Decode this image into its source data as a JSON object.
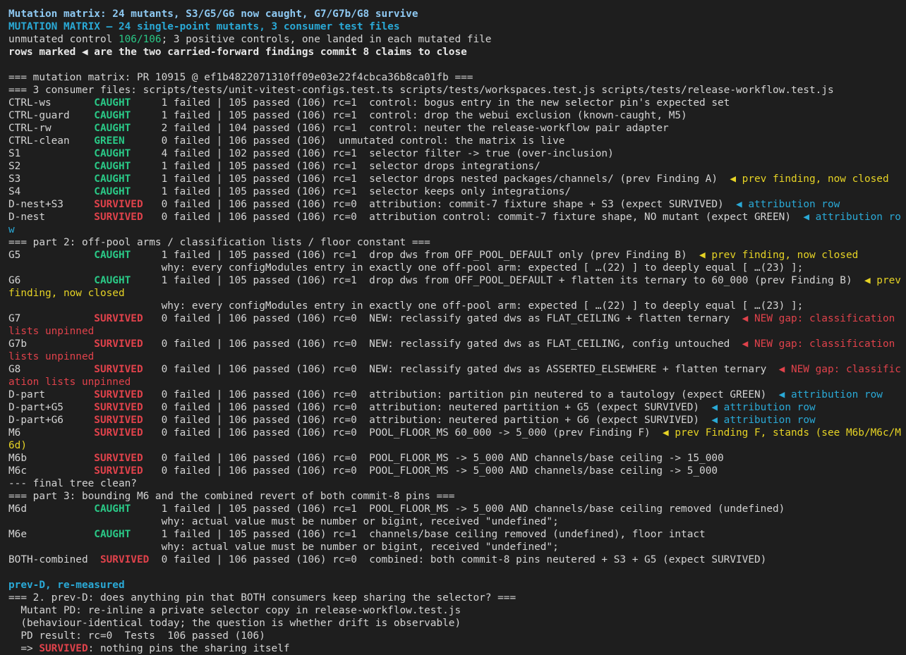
{
  "window": {
    "background": "#1e1e1e",
    "foreground": "#d4d4d4"
  },
  "colors": {
    "title": "#8ec9f2",
    "header": "#2aa9d6",
    "caught": "#2ac987",
    "survived": "#e0424b",
    "prev_finding": "#e6d325",
    "attribution": "#2aa9d6"
  },
  "lines": [
    {
      "name": "summary-title",
      "segs": [
        {
          "t": "Mutation matrix: 24 mutants, S3/G5/G6 now caught, G7/G7b/G8 survive",
          "c": "c-title bold"
        }
      ]
    },
    {
      "name": "summary-header",
      "segs": [
        {
          "t": "MUTATION MATRIX — 24 single-point mutants, 3 consumer test files",
          "c": "c-header bold"
        }
      ]
    },
    {
      "name": "summary-line",
      "segs": [
        {
          "t": "unmutated control "
        },
        {
          "t": "106/106",
          "c": "c-green"
        },
        {
          "t": "; 3 positive controls, one landed in each mutated file"
        }
      ]
    },
    {
      "name": "summary-line",
      "segs": [
        {
          "t": "rows marked ◀ are the two carried-forward findings commit 8 claims to close",
          "c": "c-white bold"
        }
      ]
    },
    {
      "name": "blank-line",
      "segs": [
        {
          "t": ""
        }
      ]
    },
    {
      "name": "section-header",
      "segs": [
        {
          "t": "=== mutation matrix: PR 10915 @ ef1b4822071310ff09e03e22f4cbca36b8ca01fb ==="
        }
      ]
    },
    {
      "name": "section-header",
      "segs": [
        {
          "t": "=== 3 consumer files: scripts/tests/unit-vitest-configs.test.ts scripts/tests/workspaces.test.js scripts/tests/release-workflow.test.js"
        }
      ]
    },
    {
      "name": "matrix-row",
      "segs": [
        {
          "t": "CTRL-ws       "
        },
        {
          "t": "CAUGHT",
          "c": "c-green bold"
        },
        {
          "t": "     1 failed | 105 passed (106) rc=1  control: bogus entry in the new selector pin's expected set"
        }
      ]
    },
    {
      "name": "matrix-row",
      "segs": [
        {
          "t": "CTRL-guard    "
        },
        {
          "t": "CAUGHT",
          "c": "c-green bold"
        },
        {
          "t": "     1 failed | 105 passed (106) rc=1  control: drop the webui exclusion (known-caught, M5)"
        }
      ]
    },
    {
      "name": "matrix-row",
      "segs": [
        {
          "t": "CTRL-rw       "
        },
        {
          "t": "CAUGHT",
          "c": "c-green bold"
        },
        {
          "t": "     2 failed | 104 passed (106) rc=1  control: neuter the release-workflow pair adapter"
        }
      ]
    },
    {
      "name": "matrix-row",
      "segs": [
        {
          "t": "CTRL-clean    "
        },
        {
          "t": "GREEN",
          "c": "c-green bold"
        },
        {
          "t": "      0 failed | 106 passed (106)  unmutated control: the matrix is live"
        }
      ]
    },
    {
      "name": "matrix-row",
      "segs": [
        {
          "t": "S1            "
        },
        {
          "t": "CAUGHT",
          "c": "c-green bold"
        },
        {
          "t": "     4 failed | 102 passed (106) rc=1  selector filter -> true (over-inclusion)"
        }
      ]
    },
    {
      "name": "matrix-row",
      "segs": [
        {
          "t": "S2            "
        },
        {
          "t": "CAUGHT",
          "c": "c-green bold"
        },
        {
          "t": "     1 failed | 105 passed (106) rc=1  selector drops integrations/"
        }
      ]
    },
    {
      "name": "matrix-row",
      "segs": [
        {
          "t": "S3            "
        },
        {
          "t": "CAUGHT",
          "c": "c-green bold"
        },
        {
          "t": "     1 failed | 105 passed (106) rc=1  selector drops nested packages/channels/ (prev Finding A)  "
        },
        {
          "t": "◀ prev finding, now closed",
          "c": "c-yellow"
        }
      ]
    },
    {
      "name": "matrix-row",
      "segs": [
        {
          "t": "S4            "
        },
        {
          "t": "CAUGHT",
          "c": "c-green bold"
        },
        {
          "t": "     1 failed | 105 passed (106) rc=1  selector keeps only integrations/"
        }
      ]
    },
    {
      "name": "matrix-row",
      "segs": [
        {
          "t": "D-nest+S3     "
        },
        {
          "t": "SURVIVED",
          "c": "c-red bold"
        },
        {
          "t": "   0 failed | 106 passed (106) rc=0  attribution: commit-7 fixture shape + S3 (expect SURVIVED)  "
        },
        {
          "t": "◀ attribution row",
          "c": "c-blue"
        }
      ]
    },
    {
      "name": "matrix-row",
      "segs": [
        {
          "t": "D-nest        "
        },
        {
          "t": "SURVIVED",
          "c": "c-red bold"
        },
        {
          "t": "   0 failed | 106 passed (106) rc=0  attribution control: commit-7 fixture shape, NO mutant (expect GREEN)  "
        },
        {
          "t": "◀ attribution row",
          "c": "c-blue"
        }
      ]
    },
    {
      "name": "section-header",
      "segs": [
        {
          "t": "=== part 2: off-pool arms / classification lists / floor constant ==="
        }
      ]
    },
    {
      "name": "matrix-row",
      "segs": [
        {
          "t": "G5            "
        },
        {
          "t": "CAUGHT",
          "c": "c-green bold"
        },
        {
          "t": "     1 failed | 105 passed (106) rc=1  drop dws from OFF_POOL_DEFAULT only (prev Finding B)  "
        },
        {
          "t": "◀ prev finding, now closed",
          "c": "c-yellow"
        }
      ]
    },
    {
      "name": "why-line",
      "segs": [
        {
          "t": "                         why: every configModules entry in exactly one off-pool arm: expected [ …(22) ] to deeply equal [ …(23) ];"
        }
      ]
    },
    {
      "name": "matrix-row",
      "segs": [
        {
          "t": "G6            "
        },
        {
          "t": "CAUGHT",
          "c": "c-green bold"
        },
        {
          "t": "     1 failed | 105 passed (106) rc=1  drop dws from OFF_POOL_DEFAULT + flatten its ternary to 60_000 (prev Finding B)  "
        },
        {
          "t": "◀ prev finding, now closed",
          "c": "c-yellow"
        }
      ]
    },
    {
      "name": "why-line",
      "segs": [
        {
          "t": "                         why: every configModules entry in exactly one off-pool arm: expected [ …(22) ] to deeply equal [ …(23) ];"
        }
      ]
    },
    {
      "name": "matrix-row",
      "segs": [
        {
          "t": "G7            "
        },
        {
          "t": "SURVIVED",
          "c": "c-red bold"
        },
        {
          "t": "   0 failed | 106 passed (106) rc=0  NEW: reclassify gated dws as FLAT_CEILING + flatten ternary  "
        },
        {
          "t": "◀ NEW gap: classification lists unpinned",
          "c": "c-red"
        }
      ]
    },
    {
      "name": "matrix-row",
      "segs": [
        {
          "t": "G7b           "
        },
        {
          "t": "SURVIVED",
          "c": "c-red bold"
        },
        {
          "t": "   0 failed | 106 passed (106) rc=0  NEW: reclassify gated dws as FLAT_CEILING, config untouched  "
        },
        {
          "t": "◀ NEW gap: classification lists unpinned",
          "c": "c-red"
        }
      ]
    },
    {
      "name": "matrix-row",
      "segs": [
        {
          "t": "G8            "
        },
        {
          "t": "SURVIVED",
          "c": "c-red bold"
        },
        {
          "t": "   0 failed | 106 passed (106) rc=0  NEW: reclassify gated dws as ASSERTED_ELSEWHERE + flatten ternary  "
        },
        {
          "t": "◀ NEW gap: classification lists unpinned",
          "c": "c-red"
        }
      ]
    },
    {
      "name": "matrix-row",
      "segs": [
        {
          "t": "D-part        "
        },
        {
          "t": "SURVIVED",
          "c": "c-red bold"
        },
        {
          "t": "   0 failed | 106 passed (106) rc=0  attribution: partition pin neutered to a tautology (expect GREEN)  "
        },
        {
          "t": "◀ attribution row",
          "c": "c-blue"
        }
      ]
    },
    {
      "name": "matrix-row",
      "segs": [
        {
          "t": "D-part+G5     "
        },
        {
          "t": "SURVIVED",
          "c": "c-red bold"
        },
        {
          "t": "   0 failed | 106 passed (106) rc=0  attribution: neutered partition + G5 (expect SURVIVED)  "
        },
        {
          "t": "◀ attribution row",
          "c": "c-blue"
        }
      ]
    },
    {
      "name": "matrix-row",
      "segs": [
        {
          "t": "D-part+G6     "
        },
        {
          "t": "SURVIVED",
          "c": "c-red bold"
        },
        {
          "t": "   0 failed | 106 passed (106) rc=0  attribution: neutered partition + G6 (expect SURVIVED)  "
        },
        {
          "t": "◀ attribution row",
          "c": "c-blue"
        }
      ]
    },
    {
      "name": "matrix-row",
      "segs": [
        {
          "t": "M6            "
        },
        {
          "t": "SURVIVED",
          "c": "c-red bold"
        },
        {
          "t": "   0 failed | 106 passed (106) rc=0  POOL_FLOOR_MS 60_000 -> 5_000 (prev Finding F)  "
        },
        {
          "t": "◀ prev Finding F, stands (see M6b/M6c/M6d)",
          "c": "c-yellow"
        }
      ]
    },
    {
      "name": "matrix-row",
      "segs": [
        {
          "t": "M6b           "
        },
        {
          "t": "SURVIVED",
          "c": "c-red bold"
        },
        {
          "t": "   0 failed | 106 passed (106) rc=0  POOL_FLOOR_MS -> 5_000 AND channels/base ceiling -> 15_000"
        }
      ]
    },
    {
      "name": "matrix-row",
      "segs": [
        {
          "t": "M6c           "
        },
        {
          "t": "SURVIVED",
          "c": "c-red bold"
        },
        {
          "t": "   0 failed | 106 passed (106) rc=0  POOL_FLOOR_MS -> 5_000 AND channels/base ceiling -> 5_000"
        }
      ]
    },
    {
      "name": "section-header",
      "segs": [
        {
          "t": "--- final tree clean?"
        }
      ]
    },
    {
      "name": "section-header",
      "segs": [
        {
          "t": "=== part 3: bounding M6 and the combined revert of both commit-8 pins ==="
        }
      ]
    },
    {
      "name": "matrix-row",
      "segs": [
        {
          "t": "M6d           "
        },
        {
          "t": "CAUGHT",
          "c": "c-green bold"
        },
        {
          "t": "     1 failed | 105 passed (106) rc=1  POOL_FLOOR_MS -> 5_000 AND channels/base ceiling removed (undefined)"
        }
      ]
    },
    {
      "name": "why-line",
      "segs": [
        {
          "t": "                         why: actual value must be number or bigint, received \"undefined\";"
        }
      ]
    },
    {
      "name": "matrix-row",
      "segs": [
        {
          "t": "M6e           "
        },
        {
          "t": "CAUGHT",
          "c": "c-green bold"
        },
        {
          "t": "     1 failed | 105 passed (106) rc=1  channels/base ceiling removed (undefined), floor intact"
        }
      ]
    },
    {
      "name": "why-line",
      "segs": [
        {
          "t": "                         why: actual value must be number or bigint, received \"undefined\";"
        }
      ]
    },
    {
      "name": "matrix-row",
      "segs": [
        {
          "t": "BOTH-combined  "
        },
        {
          "t": "SURVIVED",
          "c": "c-red bold"
        },
        {
          "t": "  0 failed | 106 passed (106) rc=0  combined: both commit-8 pins neutered + S3 + G5 (expect SURVIVED)"
        }
      ]
    },
    {
      "name": "blank-line",
      "segs": [
        {
          "t": ""
        }
      ]
    },
    {
      "name": "prev-d-header",
      "segs": [
        {
          "t": "prev-D, re-measured",
          "c": "c-header bold"
        }
      ]
    },
    {
      "name": "section-header",
      "segs": [
        {
          "t": "=== 2. prev-D: does anything pin that BOTH consumers keep sharing the selector? ==="
        }
      ]
    },
    {
      "name": "prev-d-line",
      "segs": [
        {
          "t": "  Mutant PD: re-inline a private selector copy in release-workflow.test.js"
        }
      ]
    },
    {
      "name": "prev-d-line",
      "segs": [
        {
          "t": "  (behaviour-identical today; the question is whether drift is observable)"
        }
      ]
    },
    {
      "name": "prev-d-line",
      "segs": [
        {
          "t": "  PD result: rc=0  Tests  106 passed (106)"
        }
      ]
    },
    {
      "name": "prev-d-line",
      "segs": [
        {
          "t": "  => "
        },
        {
          "t": "SURVIVED",
          "c": "c-red bold"
        },
        {
          "t": ": nothing pins the sharing itself"
        }
      ]
    }
  ]
}
